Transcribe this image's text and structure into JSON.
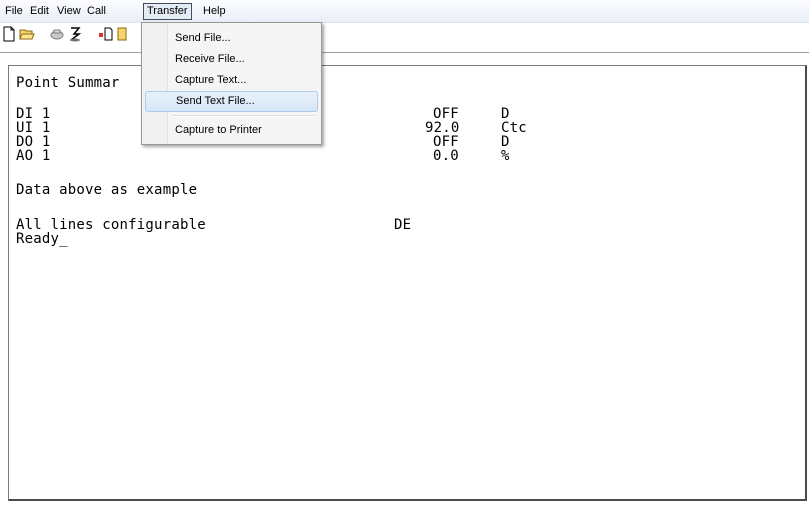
{
  "menubar": {
    "items": [
      "File",
      "Edit",
      "View",
      "Call",
      "Transfer",
      "Help"
    ]
  },
  "toolbar": {
    "buttons": [
      "new-document-icon",
      "open-folder-icon",
      "disconnect-icon",
      "connect-icon",
      "properties-icon"
    ]
  },
  "transfer_menu": {
    "items": [
      "Send File...",
      "Receive File...",
      "Capture Text...",
      "Send Text File...",
      "Capture to Printer"
    ],
    "highlighted_index": 3
  },
  "terminal": {
    "heading": "Point Summar",
    "rows": [
      {
        "name": "DI 1",
        "value": "OFF",
        "unit": "D"
      },
      {
        "name": "UI 1",
        "value": "92.0",
        "unit": "Ctc"
      },
      {
        "name": "DO 1",
        "value": "OFF",
        "unit": "D"
      },
      {
        "name": "AO 1",
        "value": "0.0",
        "unit": "%"
      }
    ],
    "note": "Data above as example",
    "config_line": "All lines configurable",
    "config_flag": "DE",
    "prompt": "Ready_"
  },
  "colors": {
    "menu_highlight": "#d6e6f7",
    "menu_border": "#aecbf0",
    "terminal_border": "#4a4a4a"
  }
}
